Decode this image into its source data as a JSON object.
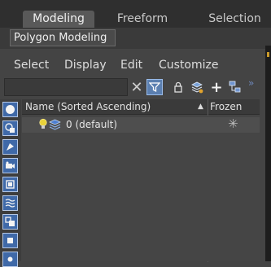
{
  "ribbon": {
    "tabs": [
      {
        "label": "Modeling",
        "active": true
      },
      {
        "label": "Freeform",
        "active": false
      },
      {
        "label": "Selection",
        "active": false
      }
    ],
    "panel_label": "Polygon Modeling"
  },
  "menu": [
    "Select",
    "Display",
    "Edit",
    "Customize"
  ],
  "toolbar": {
    "search_value": "",
    "clear_icon": "✕",
    "add_icon": "+",
    "more_icon": "»",
    "icons": [
      "close-icon",
      "filter-icon",
      "lock-icon",
      "layers-add-icon",
      "plus-icon",
      "hierarchy-icon"
    ]
  },
  "table": {
    "columns": [
      "Name (Sorted Ascending)",
      "Frozen"
    ],
    "sort_indicator": "▲",
    "rows": [
      {
        "name": "0 (default)",
        "frozen_icon": "✳"
      }
    ]
  },
  "left_toolbar_icons": [
    "sphere-icon",
    "shapes-icon",
    "light-icon",
    "camera-icon",
    "helper-icon",
    "spacewarp-icon",
    "group-icon",
    "box-icon",
    "link-icon"
  ],
  "colors": {
    "accent_blue": "#3f69a8",
    "filter_active": "#5b7fb0",
    "bulb_yellow": "#e8d23a"
  }
}
